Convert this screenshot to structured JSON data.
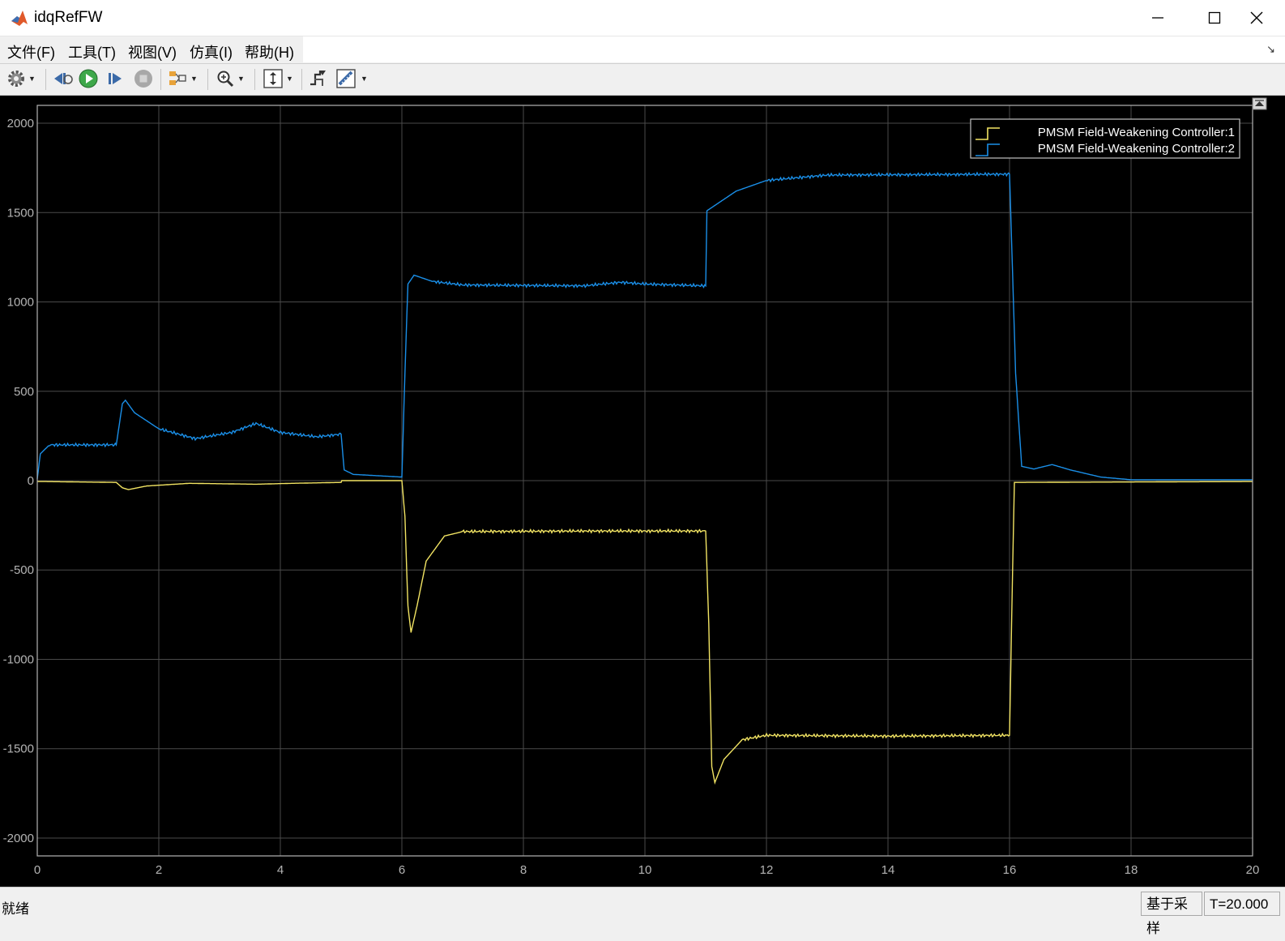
{
  "window": {
    "title": "idqRefFW"
  },
  "menu": {
    "items": [
      {
        "label": "文件(F)"
      },
      {
        "label": "工具(T)"
      },
      {
        "label": "视图(V)"
      },
      {
        "label": "仿真(I)"
      },
      {
        "label": "帮助(H)"
      }
    ]
  },
  "toolbar": {
    "icons": [
      "gear-icon",
      "step-back-icon",
      "run-icon",
      "step-forward-icon",
      "stop-icon",
      "highlight-icon",
      "zoom-icon",
      "scale-axes-icon",
      "triggers-icon",
      "measurements-icon"
    ]
  },
  "status": {
    "text": "就绪",
    "mode": "基于采样",
    "time": "T=20.000"
  },
  "colors": {
    "series1": "#f2e463",
    "series2": "#1a8fe8",
    "background": "#000000",
    "grid": "#4a4a4a",
    "axis": "#b4b4b4"
  },
  "chart_data": {
    "type": "line",
    "xlim": [
      0,
      20
    ],
    "ylim": [
      -2100,
      2100
    ],
    "xticks": [
      0,
      2,
      4,
      6,
      8,
      10,
      12,
      14,
      16,
      18,
      20
    ],
    "yticks": [
      -2000,
      -1500,
      -1000,
      -500,
      0,
      500,
      1000,
      1500,
      2000
    ],
    "grid": true,
    "legend": "top-right",
    "series": [
      {
        "name": "PMSM Field-Weakening Controller:1",
        "color": "#f2e463",
        "points": [
          [
            0,
            -5
          ],
          [
            0.1,
            -5
          ],
          [
            1.3,
            -10
          ],
          [
            1.4,
            -40
          ],
          [
            1.5,
            -50
          ],
          [
            1.8,
            -30
          ],
          [
            2.5,
            -15
          ],
          [
            3.6,
            -20
          ],
          [
            4.2,
            -15
          ],
          [
            5.0,
            -10
          ],
          [
            5.01,
            0
          ],
          [
            6.0,
            0
          ],
          [
            6.05,
            -200
          ],
          [
            6.1,
            -700
          ],
          [
            6.15,
            -850
          ],
          [
            6.25,
            -700
          ],
          [
            6.4,
            -450
          ],
          [
            6.7,
            -310
          ],
          [
            7.0,
            -285
          ],
          [
            9.0,
            -282
          ],
          [
            11.0,
            -282
          ],
          [
            11.05,
            -800
          ],
          [
            11.1,
            -1600
          ],
          [
            11.15,
            -1690
          ],
          [
            11.3,
            -1560
          ],
          [
            11.6,
            -1450
          ],
          [
            12.0,
            -1425
          ],
          [
            14.0,
            -1430
          ],
          [
            16.0,
            -1425
          ],
          [
            16.05,
            -500
          ],
          [
            16.08,
            -10
          ],
          [
            20.0,
            -5
          ]
        ]
      },
      {
        "name": "PMSM Field-Weakening Controller:2",
        "color": "#1a8fe8",
        "points": [
          [
            0,
            10
          ],
          [
            0.05,
            150
          ],
          [
            0.2,
            200
          ],
          [
            1.3,
            200
          ],
          [
            1.4,
            430
          ],
          [
            1.45,
            450
          ],
          [
            1.6,
            380
          ],
          [
            2.0,
            290
          ],
          [
            2.6,
            235
          ],
          [
            3.2,
            270
          ],
          [
            3.6,
            320
          ],
          [
            4.0,
            270
          ],
          [
            4.6,
            245
          ],
          [
            5.0,
            260
          ],
          [
            5.05,
            60
          ],
          [
            5.2,
            35
          ],
          [
            6.0,
            20
          ],
          [
            6.05,
            600
          ],
          [
            6.1,
            1100
          ],
          [
            6.2,
            1150
          ],
          [
            6.5,
            1115
          ],
          [
            7.0,
            1095
          ],
          [
            9.0,
            1090
          ],
          [
            9.6,
            1110
          ],
          [
            10.0,
            1100
          ],
          [
            11.0,
            1090
          ],
          [
            11.02,
            1510
          ],
          [
            11.5,
            1620
          ],
          [
            12.0,
            1680
          ],
          [
            13.0,
            1710
          ],
          [
            16.0,
            1715
          ],
          [
            16.1,
            600
          ],
          [
            16.2,
            80
          ],
          [
            16.4,
            65
          ],
          [
            16.7,
            90
          ],
          [
            17.0,
            60
          ],
          [
            17.5,
            20
          ],
          [
            18.0,
            5
          ],
          [
            20.0,
            5
          ]
        ]
      }
    ]
  }
}
